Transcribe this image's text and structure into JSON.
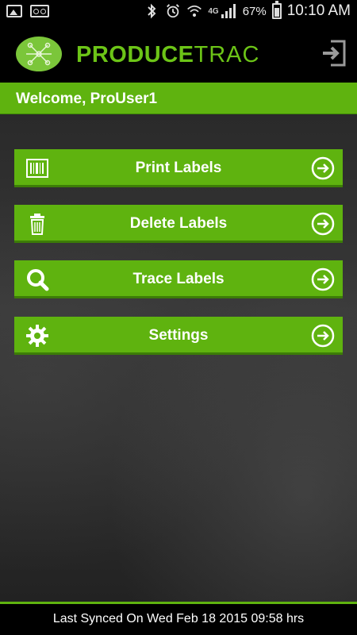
{
  "status_bar": {
    "battery_percent": "67%",
    "time": "10:10 AM",
    "network": "4G",
    "icons": [
      "gallery-icon",
      "voicemail-icon",
      "bluetooth-icon",
      "alarm-icon",
      "wifi-icon",
      "signal-icon",
      "battery-icon"
    ]
  },
  "header": {
    "brand_bold": "PRODUCE",
    "brand_light": "TRAC",
    "logout_icon": "logout-icon"
  },
  "welcome": {
    "text": "Welcome, ProUser1"
  },
  "menu": {
    "items": [
      {
        "label": "Print Labels",
        "icon": "barcode-icon"
      },
      {
        "label": "Delete Labels",
        "icon": "trash-icon"
      },
      {
        "label": "Trace Labels",
        "icon": "search-icon"
      },
      {
        "label": "Settings",
        "icon": "gear-icon"
      }
    ]
  },
  "footer": {
    "sync_text": "Last Synced On Wed Feb 18 2015 09:58 hrs"
  },
  "colors": {
    "accent": "#5fb30f",
    "brand_green": "#6cc417",
    "background": "#000000"
  }
}
